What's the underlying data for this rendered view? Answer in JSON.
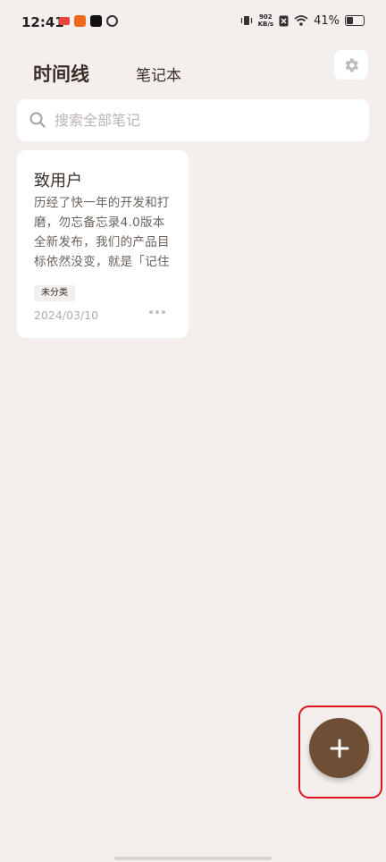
{
  "status_bar": {
    "time": "12:41",
    "net_speed_value": "902",
    "net_speed_unit": "KB/s",
    "battery": "41%",
    "battery_level": 0.41
  },
  "tabs": {
    "timeline": "时间线",
    "notebook": "笔记本"
  },
  "search": {
    "placeholder": "搜索全部笔记"
  },
  "notes": [
    {
      "title": "致用户",
      "body": "历经了快一年的开发和打磨，勿忘备忘录4.0版本全新发布，我们的产品目标依然没变，就是「记住你生活中每一个值",
      "tag": "未分类",
      "date": "2024/03/10"
    }
  ],
  "colors": {
    "background": "#f4efec",
    "accent": "#6e4f36",
    "highlight": "#e0121d"
  }
}
